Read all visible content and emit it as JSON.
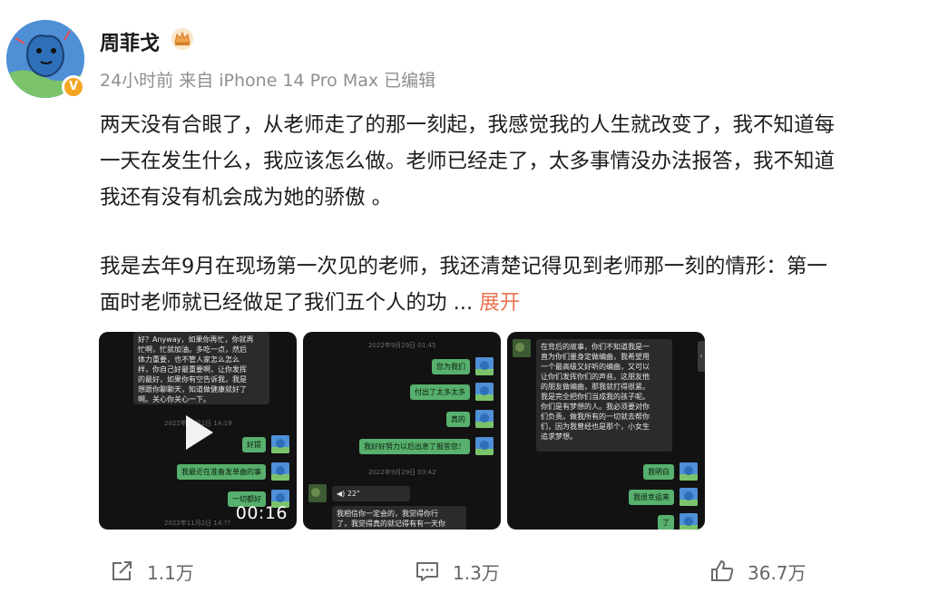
{
  "post": {
    "username": "周菲戈",
    "meta": "24小时前  来自 iPhone 14 Pro Max 已编辑",
    "verified_badge": "V",
    "paragraph1": [
      "两天没有合眼了，从老师走了的那一刻起，我感觉我的人生就改变了，我不知道每",
      "一天在发生什么，我应该怎么做。老师已经走了，太多事情没办法报答，我不知道",
      "我还有没有机会成为她的骄傲 。"
    ],
    "paragraph2": [
      "我是去年9月在现场第一次见的老师，我还清楚记得见到老师那一刻的情形：第一",
      "面时老师就已经做足了我们五个人的功  ..."
    ],
    "expand_label": "展开"
  },
  "media": [
    {
      "type": "video",
      "duration": "00:16",
      "top_message": [
        "好？Anyway，如果你再忙，你就再",
        "忙啊，忙就加油。多吃一点，然后",
        "体力重要，也不管人家怎么怎么",
        "样，你自己好最重要啊，让你发挥",
        "的最好，如果你有空告诉我，我是",
        "想跟你聊聊天，知道做健康就好了",
        "啊。关心你关心一下。"
      ],
      "timestamp1": "2022年11月2日 14:19",
      "msgs": [
        "好提",
        "我最近在准备发单曲的事",
        "一切都好"
      ],
      "timestamp2": "2022年11月2日 14:??"
    },
    {
      "type": "image",
      "timestamp1": "2022年9月29日 01:45",
      "msgs": [
        "您为我们",
        "付出了太多太多",
        "真的",
        "我好好努力以后出息了报答您！"
      ],
      "timestamp2": "2022年9月29日 03:42",
      "voice": "22\"",
      "reply": [
        "我相信你一定会的，我觉得你行",
        "了，我觉得真的就记得有有一天你"
      ]
    },
    {
      "type": "image",
      "long_message": [
        "在背后的故事，你们不知道我是一",
        "直为你们量身定做编曲，我希望用",
        "一个最高级又好听的编曲，又可以",
        "让你们发挥你们的声音。这朋友他",
        "的朋友做编曲，那我就打得很紧。",
        "我是完全把你们当成我的孩子呢。",
        "你们是有梦想的人。我必须要对你",
        "们负责。做我所有的一切就去帮你",
        "们，因为我曾经也是那个，小女生",
        "追求梦想。"
      ],
      "msgs": [
        "我明白",
        "我很幸运来",
        "了"
      ]
    }
  ],
  "actions": {
    "share_count": "1.1万",
    "comment_count": "1.3万",
    "like_count": "36.7万"
  },
  "colors": {
    "expand": "#eb7350",
    "meta": "#8f8f8f",
    "wechat_green": "#57b06d"
  }
}
